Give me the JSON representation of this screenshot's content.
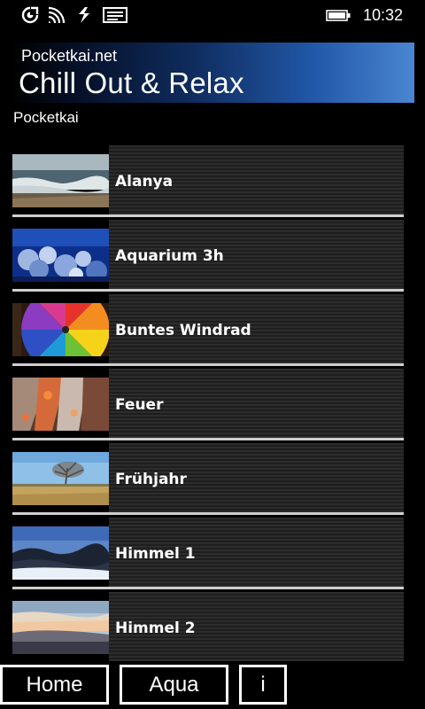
{
  "status_bar": {
    "time": "10:32",
    "icons": [
      "sync-icon",
      "wifi-icon",
      "data-connection-icon",
      "message-icon",
      "battery-icon"
    ]
  },
  "header": {
    "site": "Pocketkai.net",
    "title": "Chill Out & Relax",
    "publisher": "Pocketkai"
  },
  "list": {
    "items": [
      {
        "label": "Alanya",
        "thumbnail": "beach-waves"
      },
      {
        "label": "Aquarium 3h",
        "thumbnail": "aquarium-coral"
      },
      {
        "label": "Buntes Windrad",
        "thumbnail": "colorful-pinwheel"
      },
      {
        "label": "Feuer",
        "thumbnail": "fire-embers"
      },
      {
        "label": "Frühjahr",
        "thumbnail": "spring-field-tree"
      },
      {
        "label": "Himmel 1",
        "thumbnail": "dark-sky-clouds"
      },
      {
        "label": "Himmel 2",
        "thumbnail": "sunset-sky"
      }
    ]
  },
  "bottom_bar": {
    "home_label": "Home",
    "aqua_label": "Aqua",
    "info_label": "i"
  },
  "colors": {
    "background": "#000000",
    "banner_start": "#000000",
    "banner_end": "#4a86d1",
    "separator": "#cfcfcf",
    "text": "#ffffff"
  }
}
